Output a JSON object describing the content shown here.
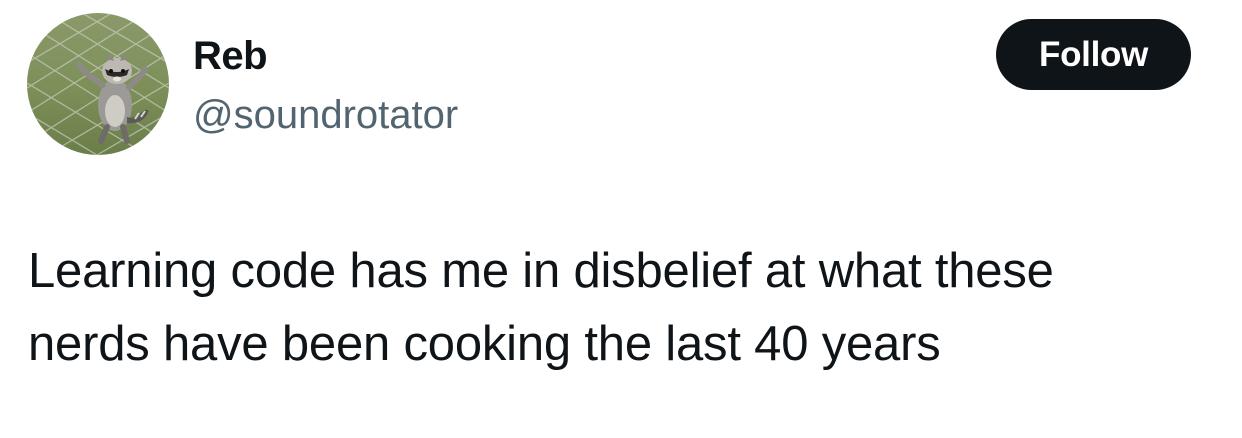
{
  "author": {
    "display_name": "Reb",
    "handle": "@soundrotator",
    "avatar_icon": "raccoon-on-fence-avatar"
  },
  "actions": {
    "follow_label": "Follow"
  },
  "tweet": {
    "text_lines": [
      "Learning code has me in disbelief at what these",
      "nerds have been cooking the last 40 years"
    ]
  },
  "colors": {
    "text_primary": "#0f1419",
    "text_secondary": "#536471",
    "button_bg": "#0f1419",
    "button_text": "#ffffff"
  }
}
